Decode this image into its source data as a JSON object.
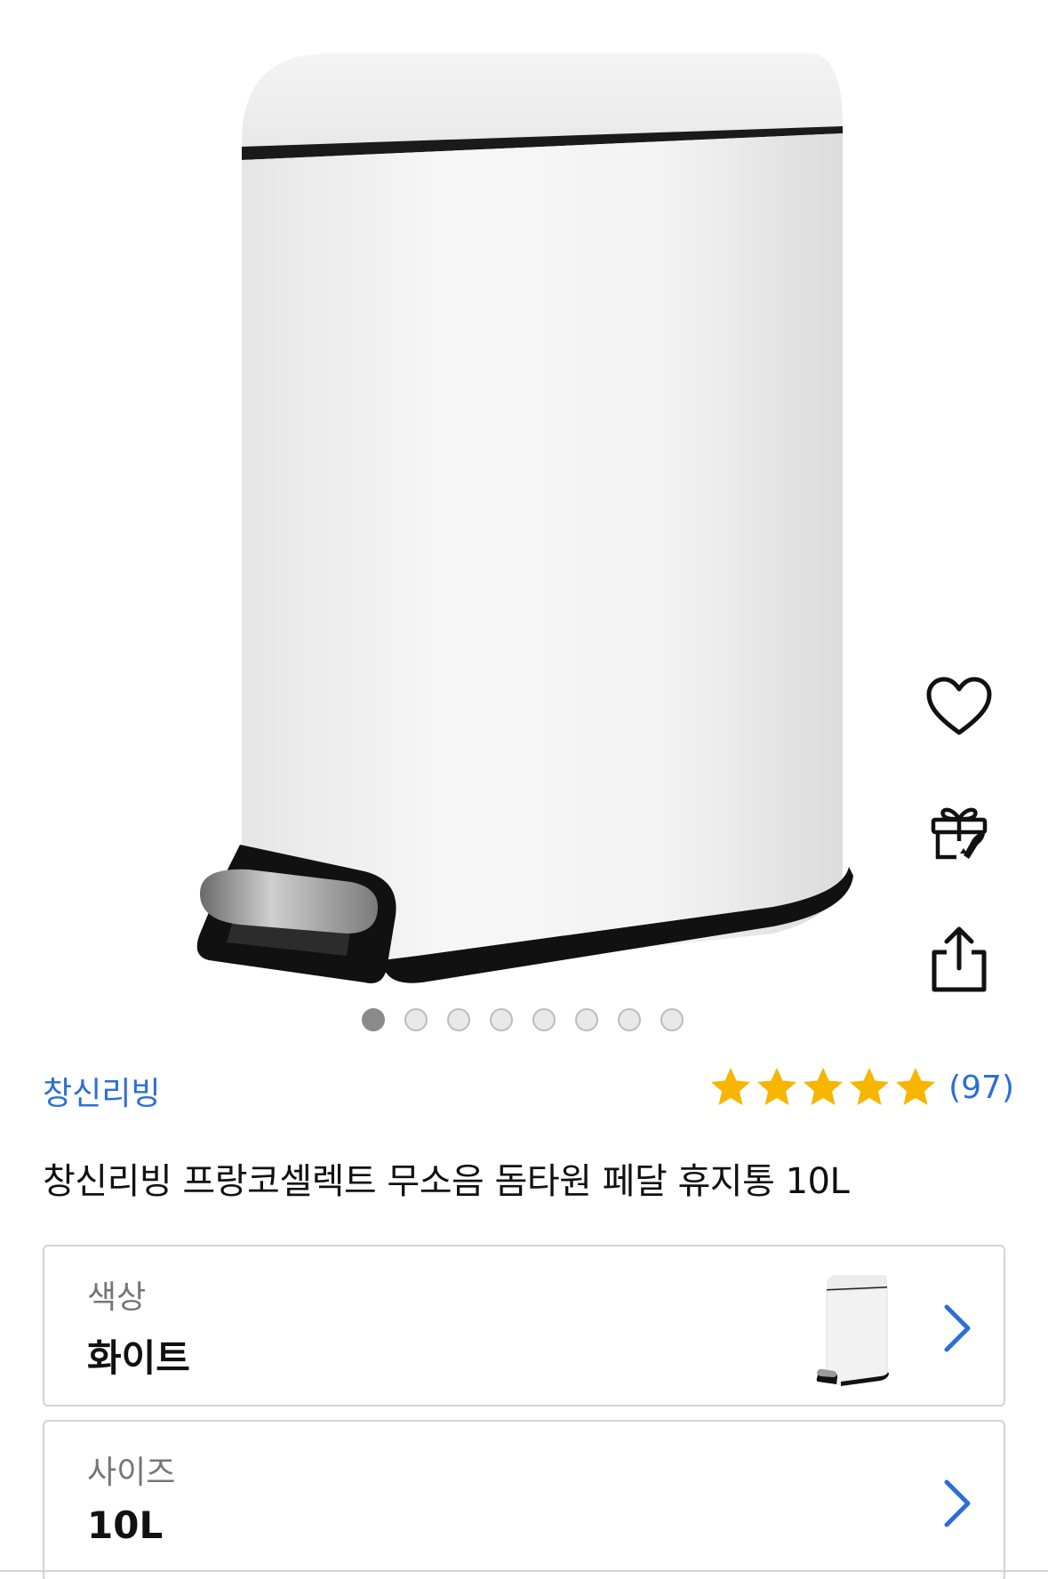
{
  "gallery": {
    "image_alt": "white pedal trash bin",
    "slide_count": 8,
    "active_index": 0
  },
  "actions": {
    "wishlist_icon": "heart-icon",
    "gift_icon": "gift-icon",
    "share_icon": "share-icon"
  },
  "product": {
    "brand": "창신리빙",
    "rating_stars": 5,
    "review_count": "(97)",
    "title": "창신리빙 프랑코셀렉트 무소음 돔타원 페달 휴지통 10L"
  },
  "options": [
    {
      "label": "색상",
      "value": "화이트",
      "has_thumbnail": true
    },
    {
      "label": "사이즈",
      "value": "10L",
      "has_thumbnail": false
    }
  ],
  "colors": {
    "accent": "#2a6fd6",
    "star": "#f7b500"
  }
}
